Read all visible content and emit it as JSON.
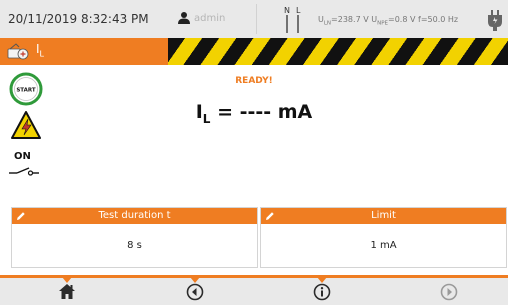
{
  "status": {
    "datetime": "20/11/2019 8:32:43 PM",
    "user": "admin",
    "mains_n_label": "N",
    "mains_l_label": "L",
    "measurements": [
      {
        "symbol": "U",
        "sub": "LN",
        "value": "=238.7 V"
      },
      {
        "symbol": "U",
        "sub": "NPE",
        "value": "=0.8 V"
      },
      {
        "symbol": "f",
        "sub": "",
        "value": "=50.0 Hz"
      }
    ]
  },
  "title": {
    "symbol": "I",
    "sub": "L"
  },
  "state": "READY!",
  "result": {
    "symbol": "I",
    "sub": "L",
    "value": " = ---- mA"
  },
  "indicators": {
    "start_label": "START",
    "switch_label": "ON"
  },
  "params": [
    {
      "label": "Test duration t",
      "value": "8 s"
    },
    {
      "label": "Limit",
      "value": "1 mA"
    }
  ],
  "toolbar": {
    "buttons": [
      "home",
      "back",
      "info",
      "next"
    ]
  },
  "colors": {
    "accent": "#ef7d22",
    "bar_bg": "#e9e9e9",
    "start_green": "#2f9a3a",
    "hazard_yellow": "#f2d200",
    "hazard_black": "#111111"
  }
}
